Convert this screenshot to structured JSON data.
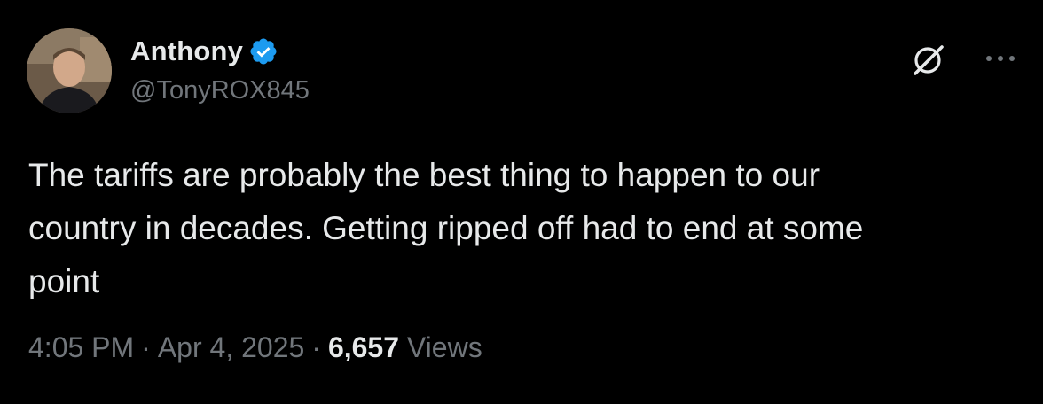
{
  "author": {
    "display_name": "Anthony",
    "handle": "@TonyROX845",
    "avatar_icon": "user-photo-avatar",
    "verified_icon": "verified-badge-icon",
    "verified_color": "#1d9bf0"
  },
  "toolbar": {
    "grok_icon": "grok-icon",
    "more_icon": "more-options-icon"
  },
  "post": {
    "text": "The tariffs are probably the best thing to happen to our\ncountry in decades. Getting ripped off had to end at some\npoint"
  },
  "meta": {
    "time": "4:05 PM",
    "date": "Apr 4, 2025",
    "views_count": "6,657",
    "views_label": "Views",
    "separator": "·"
  },
  "colors": {
    "background": "#000000",
    "primary_text": "#e7e9ea",
    "secondary_text": "#71767b"
  }
}
